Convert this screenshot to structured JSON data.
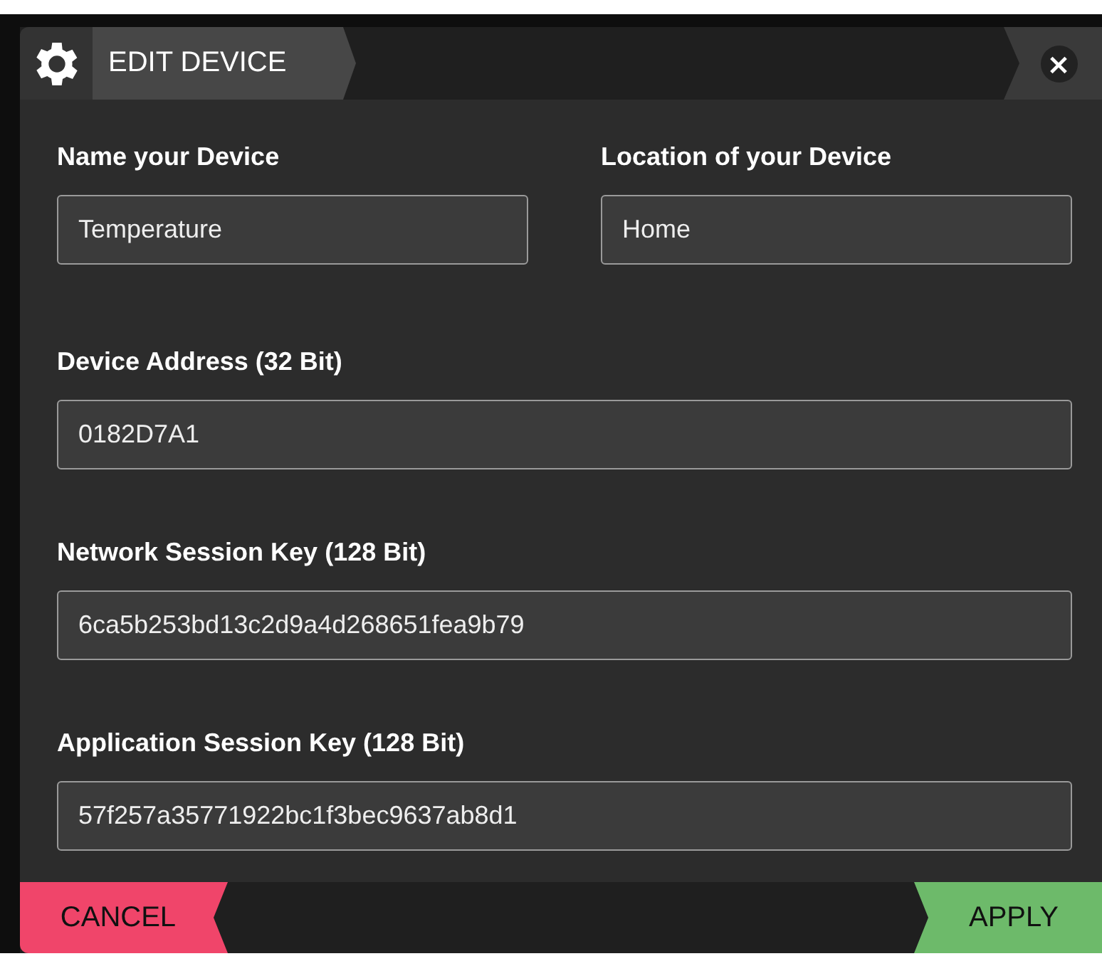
{
  "dialog": {
    "title": "EDIT DEVICE",
    "close": "×"
  },
  "rows": [
    {
      "fields": [
        {
          "label": "Name your Device",
          "value": "Temperature"
        },
        {
          "label": "Location of your Device",
          "value": "Home"
        }
      ]
    },
    {
      "fields": [
        {
          "label": "Device Address (32 Bit)",
          "value": "0182D7A1"
        }
      ]
    },
    {
      "fields": [
        {
          "label": "Network Session Key (128 Bit)",
          "value": "6ca5b253bd13c2d9a4d268651fea9b79"
        }
      ]
    },
    {
      "fields": [
        {
          "label": "Application Session Key (128 Bit)",
          "value": "57f257a35771922bc1f3bec9637ab8d1"
        }
      ]
    }
  ],
  "buttons": [
    {
      "label": "CANCEL",
      "kind": "cancel"
    },
    {
      "label": "APPLY",
      "kind": "apply"
    }
  ]
}
